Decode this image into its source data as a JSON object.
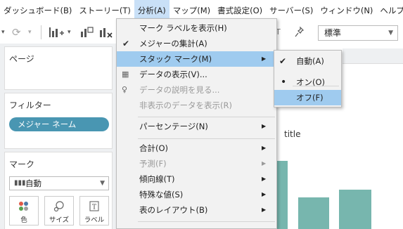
{
  "menubar": {
    "items": [
      {
        "label": "ダッシュボード(B)"
      },
      {
        "label": "ストーリー(T)"
      },
      {
        "label": "分析(A)"
      },
      {
        "label": "マップ(M)"
      },
      {
        "label": "書式設定(O)"
      },
      {
        "label": "サーバー(S)"
      },
      {
        "label": "ウィンドウ(N)"
      },
      {
        "label": "ヘルプ(H)"
      }
    ],
    "active_index": 2
  },
  "toolbar": {
    "fit_select": "標準"
  },
  "panels": {
    "pages": {
      "title": "ページ"
    },
    "filters": {
      "title": "フィルター",
      "pill": "メジャー ネーム"
    },
    "marks": {
      "title": "マーク",
      "type": "自動",
      "cards": [
        {
          "label": "色",
          "icon": "color-icon"
        },
        {
          "label": "サイズ",
          "icon": "size-icon"
        },
        {
          "label": "ラベル",
          "icon": "label-icon"
        }
      ]
    }
  },
  "chart": {
    "title": "title",
    "bar_color": "#77b6ae"
  },
  "analysis_menu": {
    "items": [
      {
        "label": "マーク ラベルを表示(H)"
      },
      {
        "label": "メジャーの集計(A)",
        "checked": true
      },
      {
        "label": "スタック マーク(M)",
        "submenu": true,
        "highlighted": true
      },
      {
        "label": "データの表示(V)...",
        "icon": "data-grid-icon"
      },
      {
        "label": "データの説明を見る...",
        "icon": "lightbulb-icon",
        "disabled": true
      },
      {
        "label": "非表示のデータを表示(R)",
        "disabled": true
      },
      {
        "label": "パーセンテージ(N)",
        "submenu": true
      },
      {
        "label": "合計(O)",
        "submenu": true
      },
      {
        "label": "予測(F)",
        "submenu": true,
        "disabled": true
      },
      {
        "label": "傾向線(T)",
        "submenu": true
      },
      {
        "label": "特殊な値(S)",
        "submenu": true
      },
      {
        "label": "表のレイアウト(B)",
        "submenu": true
      }
    ]
  },
  "stack_submenu": {
    "items": [
      {
        "label": "自動(A)",
        "checked": true
      },
      {
        "label": "オン(O)",
        "selected_dot": true
      },
      {
        "label": "オフ(F)",
        "highlighted": true
      }
    ]
  },
  "colors": {
    "menu_highlight": "#9fcbef",
    "pill": "#4996b2",
    "bar": "#77b6ae"
  }
}
